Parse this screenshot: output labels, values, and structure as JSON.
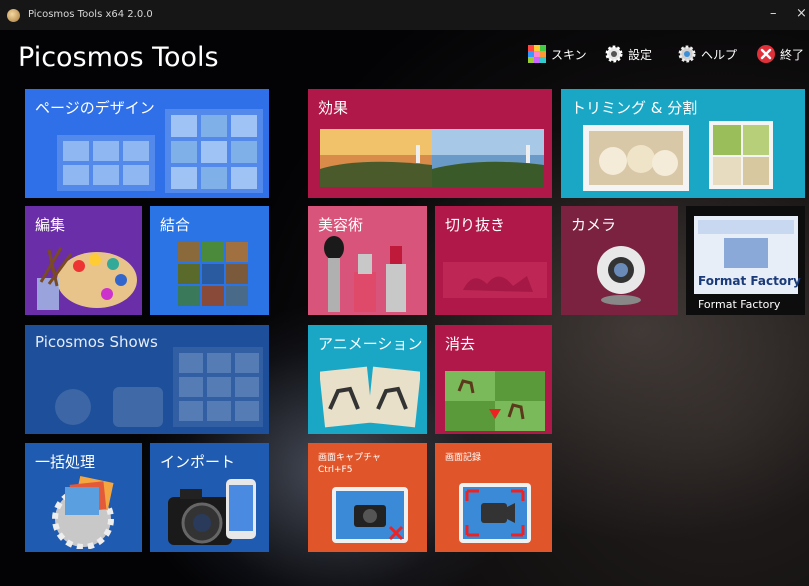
{
  "window": {
    "title": "Picosmos Tools x64 2.0.0",
    "minimize_glyph": "–",
    "close_glyph": "×"
  },
  "app": {
    "title": "Picosmos Tools"
  },
  "header": {
    "skin": {
      "label": "スキン",
      "icon": "palette-grid-icon"
    },
    "settings": {
      "label": "設定",
      "icon": "gear-icon"
    },
    "help": {
      "label": "ヘルプ",
      "icon": "help-gear-icon"
    },
    "exit": {
      "label": "終了",
      "icon": "close-circle-icon"
    }
  },
  "tiles": {
    "page_design": {
      "label": "ページのデザイン",
      "color": "#2f6fe8"
    },
    "effects": {
      "label": "効果",
      "color": "#b0184a"
    },
    "trim_split": {
      "label": "トリミング & 分割",
      "color": "#1aa7c6"
    },
    "edit": {
      "label": "編集",
      "color": "#6a2ea8"
    },
    "combine": {
      "label": "結合",
      "color": "#2a74e6"
    },
    "beauty": {
      "label": "美容術",
      "color": "#d8547a"
    },
    "cutout": {
      "label": "切り抜き",
      "color": "#b0184a"
    },
    "camera": {
      "label": "カメラ",
      "color": "#7a2240"
    },
    "format_factory": {
      "label": "Format Factory",
      "logo_text": "Format Factory",
      "color": "#0d0d0d"
    },
    "shows": {
      "label": "Picosmos Shows",
      "color": "#1e4f9a"
    },
    "animation": {
      "label": "アニメーション",
      "color": "#1aa7c6"
    },
    "erase": {
      "label": "消去",
      "color": "#b0184a"
    },
    "batch": {
      "label": "一括処理",
      "color": "#1f5bb0"
    },
    "import": {
      "label": "インポート",
      "color": "#1f5bb0"
    },
    "screen_capture": {
      "label": "画面キャプチャ",
      "shortcut": "Ctrl+F5",
      "color": "#e0562a"
    },
    "screen_record": {
      "label": "画面記録",
      "color": "#e0562a"
    }
  }
}
